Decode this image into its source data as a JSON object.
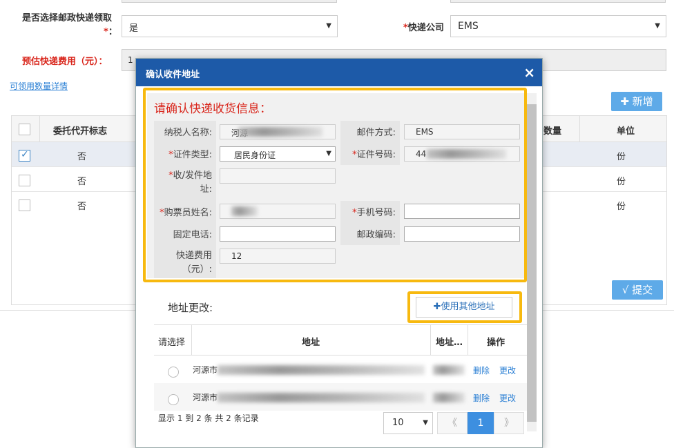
{
  "form": {
    "postal_label": "是否选择邮政快递领取",
    "postal_req": "*",
    "postal_colon": "：",
    "postal_value": "是",
    "courier_label": "快递公司",
    "courier_req": "*",
    "courier_value": "EMS",
    "fee_label": "预估快递费用（元）：",
    "fee_value_partial": "1",
    "qty_link": "可领用数量详情",
    "add_button": "新增",
    "submit_button": "√ 提交"
  },
  "table": {
    "headers": [
      "委托代开标志",
      "数量",
      "单位"
    ],
    "rows": [
      {
        "agent": "否",
        "unit": "份",
        "checked": true
      },
      {
        "agent": "否",
        "unit": "份",
        "checked": false
      },
      {
        "agent": "否",
        "unit": "份",
        "checked": false
      }
    ]
  },
  "modal": {
    "title": "确认收件地址",
    "close": "×",
    "heading": "请确认快递收货信息：",
    "taxpayer_label": "纳税人名称:",
    "taxpayer_value": "河源",
    "mail_method_label": "邮件方式:",
    "mail_method_value": "EMS",
    "id_type_label": "证件类型:",
    "id_type_value": "居民身份证",
    "id_no_label": "证件号码:",
    "id_no_value": "44",
    "address_label_1": "收/发件地",
    "address_label_2": "址:",
    "buyer_label": "购票员姓名:",
    "mobile_label": "手机号码:",
    "phone_label": "固定电话:",
    "postcode_label": "邮政编码:",
    "fee_label_1": "快递费用",
    "fee_label_2": "（元）:",
    "fee_value": "12",
    "req": "*",
    "addr_change_label": "地址更改:",
    "use_other_button": "使用其他地址",
    "addr_table": {
      "col_select": "请选择",
      "col_address": "地址",
      "col_address2": "地址…",
      "col_action": "操作",
      "rows": [
        {
          "address": "河源市",
          "delete": "删除",
          "edit": "更改"
        },
        {
          "address": "河源市",
          "delete": "删除",
          "edit": "更改"
        }
      ]
    },
    "records_text": "显示 1 到 2 条 共 2 条记录",
    "page_size": "10",
    "page_prev": "《",
    "page_current": "1",
    "page_next": "》"
  },
  "colors": {
    "modal_header": "#1d5aa8",
    "highlight": "#f7b90f",
    "required": "#d9261c",
    "button": "#5eaae8"
  }
}
